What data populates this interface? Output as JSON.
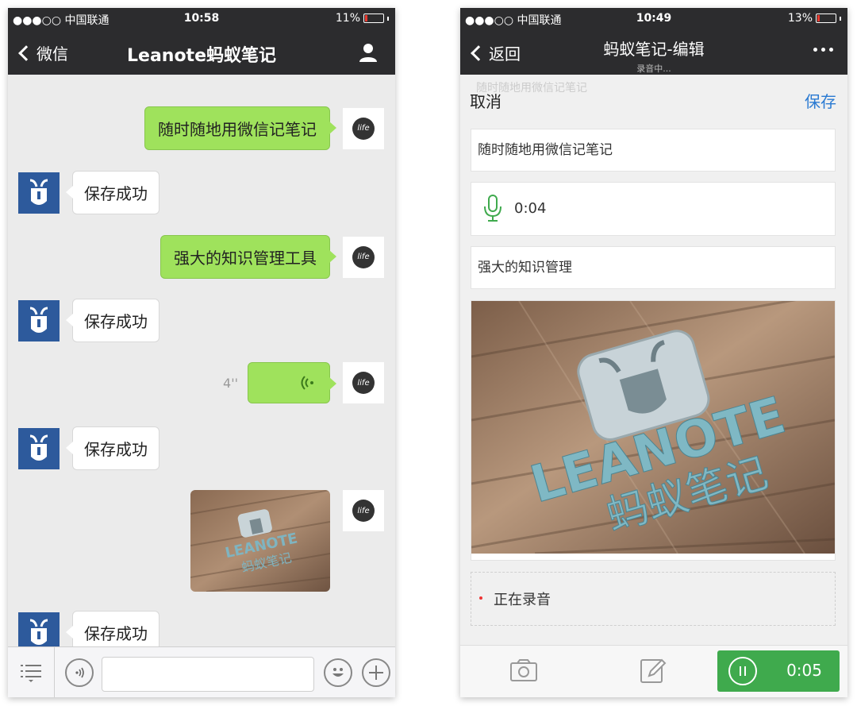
{
  "left": {
    "status": {
      "carrier": "●●●○○ 中国联通",
      "time": "10:58",
      "battery": "11%",
      "battery_level": 0.11
    },
    "nav": {
      "back_label": "微信",
      "title": "Leanote蚂蚁笔记"
    },
    "messages": {
      "sent_1": "随时随地用微信记笔记",
      "reply_1": "保存成功",
      "sent_2": "强大的知识管理工具",
      "reply_2": "保存成功",
      "voice_duration": "4''",
      "reply_3": "保存成功",
      "reply_4": "保存成功"
    },
    "avatar_text": "life",
    "image_logo": {
      "latin": "LEANOTE",
      "chinese": "蚂蚁笔记"
    }
  },
  "right": {
    "status": {
      "carrier": "●●●○○ 中国联通",
      "time": "10:49",
      "battery": "13%",
      "battery_level": 0.13
    },
    "nav": {
      "back_label": "返回",
      "title": "蚂蚁笔记-编辑",
      "subtitle": "录音中..."
    },
    "action": {
      "ghost": "随时随地用微信记笔记",
      "cancel": "取消",
      "save": "保存"
    },
    "cards": {
      "text_1": "随时随地用微信记笔记",
      "voice_time": "0:04",
      "text_2": "强大的知识管理"
    },
    "image_logo": {
      "latin": "LEANOTE",
      "chinese": "蚂蚁笔记"
    },
    "recording_label": "正在录音",
    "record_time": "0:05"
  },
  "colors": {
    "nav_bg": "#2c2c2e",
    "bubble_green": "#9fe25c",
    "save_blue": "#2a7ad2",
    "record_green": "#3faa4d",
    "bot_blue": "#2d5a9c"
  }
}
